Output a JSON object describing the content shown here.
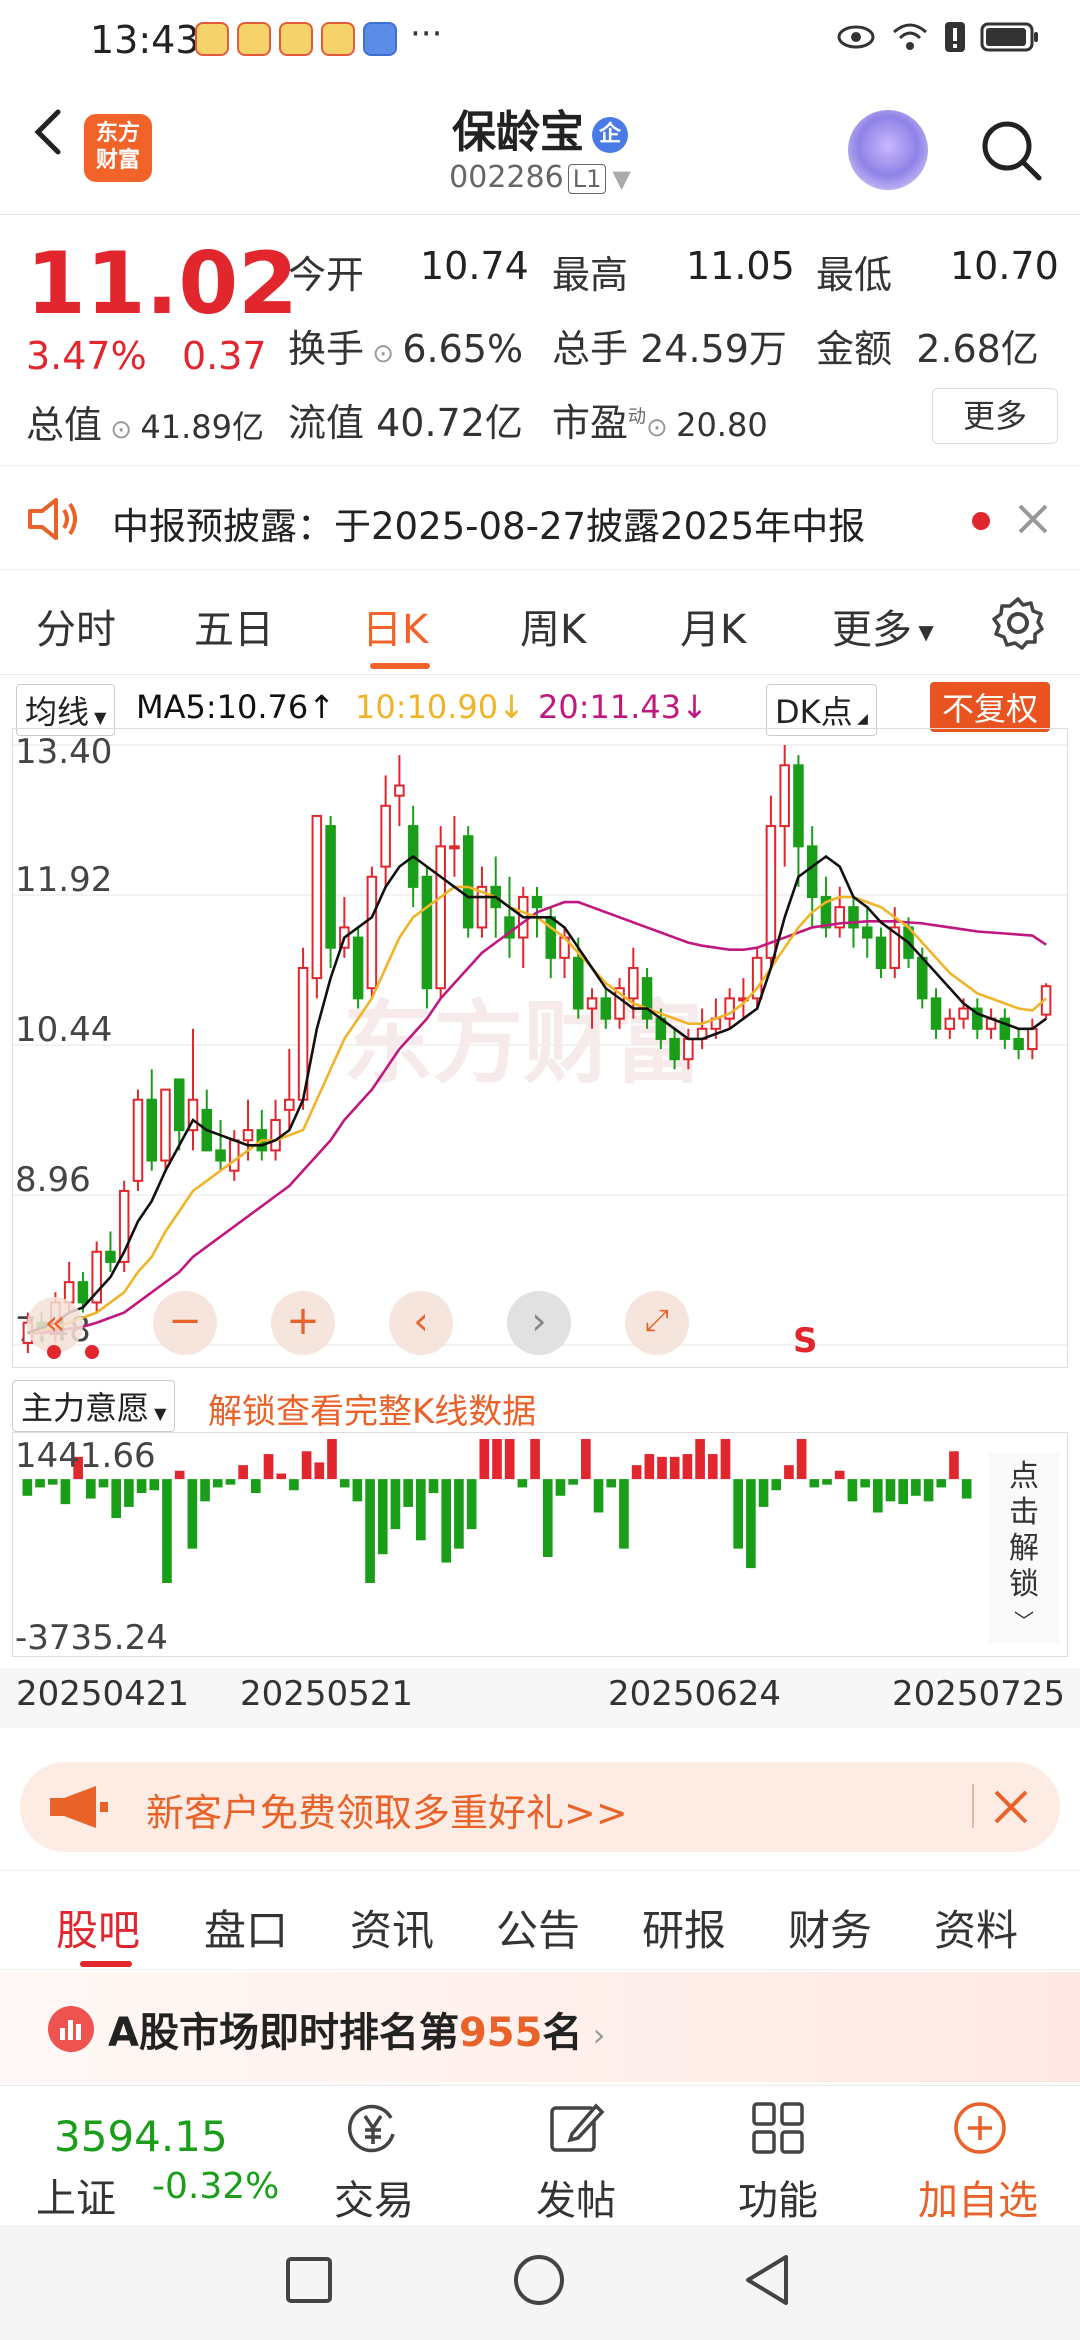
{
  "status_bar": {
    "time": "13:43",
    "dots": "···"
  },
  "header": {
    "logo_line1": "东方",
    "logo_line2": "财富",
    "stock_name": "保龄宝",
    "badge": "企",
    "stock_code": "002286",
    "level": "L1"
  },
  "quote": {
    "price": "11.02",
    "change_pct": "3.47%",
    "change_abs": "0.37",
    "open_label": "今开",
    "open": "10.74",
    "high_label": "最高",
    "high": "11.05",
    "low_label": "最低",
    "low": "10.70",
    "turnover_label": "换手",
    "turnover": "6.65%",
    "volume_label": "总手",
    "volume": "24.59万",
    "amount_label": "金额",
    "amount": "2.68亿",
    "mktcap_label": "总值",
    "mktcap": "41.89亿",
    "float_label": "流值",
    "float_cap": "40.72亿",
    "pe_label": "市盈",
    "pe_sup": "动",
    "pe": "20.80",
    "more": "更多"
  },
  "notice": {
    "text": "中报预披露：于2025-08-27披露2025年中报"
  },
  "tabs": [
    {
      "label": "分时"
    },
    {
      "label": "五日"
    },
    {
      "label": "日K"
    },
    {
      "label": "周K"
    },
    {
      "label": "月K"
    },
    {
      "label": "更多"
    }
  ],
  "chart_toolbar": {
    "ma_select": "均线",
    "ma5": "MA5:10.76↑",
    "ma10": "10:10.90↓",
    "ma20": "20:11.43↓",
    "dk": "DK点",
    "fq": "不复权"
  },
  "indicator_bar": {
    "select": "主力意愿",
    "unlock": "解锁查看完整K线数据"
  },
  "volume_side": {
    "unlock": "点击解锁"
  },
  "dates": [
    "20250421",
    "20250521",
    "20250624",
    "20250725"
  ],
  "promo": {
    "text": "新客户免费领取多重好礼>>"
  },
  "sub_tabs": [
    "股吧",
    "盘口",
    "资讯",
    "公告",
    "研报",
    "财务",
    "资料"
  ],
  "rank": {
    "prefix": "A股市场即时排名第",
    "number": "955",
    "suffix": "名"
  },
  "bottom_nav": {
    "index_value": "3594.15",
    "index_name": "上证",
    "index_change": "-0.32%",
    "trade": "交易",
    "post": "发帖",
    "func": "功能",
    "add": "加自选"
  },
  "colors": {
    "up": "#e2262e",
    "down": "#1a9e1a",
    "accent": "#f2632a",
    "ma5": "#111111",
    "ma10": "#f0b429",
    "ma20": "#c0187e"
  },
  "chart_data": {
    "type": "candlestick",
    "y_ticks": [
      "13.40",
      "11.92",
      "10.44",
      "8.96",
      "7.48"
    ],
    "ylim": [
      7.48,
      13.4
    ],
    "volume_ticks": [
      "1441.66",
      "-3735.24"
    ],
    "x_labels": [
      "20250421",
      "20250521",
      "20250624",
      "20250725"
    ],
    "legend": [
      "MA5:10.76↑",
      "10:10.90↓",
      "20:11.43↓"
    ],
    "candles": [
      [
        7.5,
        7.7,
        7.4,
        7.8
      ],
      [
        7.7,
        7.6,
        7.5,
        7.8
      ],
      [
        7.6,
        7.9,
        7.5,
        8.0
      ],
      [
        7.9,
        8.1,
        7.8,
        8.3
      ],
      [
        8.1,
        7.9,
        7.8,
        8.2
      ],
      [
        7.9,
        8.4,
        7.8,
        8.5
      ],
      [
        8.4,
        8.3,
        8.2,
        8.6
      ],
      [
        8.3,
        9.0,
        8.2,
        9.1
      ],
      [
        9.1,
        9.9,
        9.0,
        10.0
      ],
      [
        9.9,
        9.3,
        9.2,
        10.2
      ],
      [
        9.3,
        10.0,
        9.2,
        10.0
      ],
      [
        10.1,
        9.6,
        9.4,
        10.1
      ],
      [
        9.6,
        9.9,
        9.4,
        10.6
      ],
      [
        9.8,
        9.4,
        9.4,
        10.0
      ],
      [
        9.4,
        9.3,
        9.2,
        9.7
      ],
      [
        9.2,
        9.5,
        9.1,
        9.6
      ],
      [
        9.5,
        9.6,
        9.3,
        9.9
      ],
      [
        9.6,
        9.4,
        9.3,
        9.8
      ],
      [
        9.4,
        9.7,
        9.3,
        9.9
      ],
      [
        9.8,
        9.9,
        9.6,
        10.4
      ],
      [
        9.9,
        11.2,
        9.8,
        11.4
      ],
      [
        11.1,
        12.7,
        10.9,
        12.7
      ],
      [
        12.6,
        11.4,
        11.2,
        12.7
      ],
      [
        11.4,
        11.6,
        11.3,
        11.9
      ],
      [
        11.5,
        10.9,
        10.8,
        11.6
      ],
      [
        11.0,
        12.1,
        10.9,
        12.2
      ],
      [
        12.2,
        12.8,
        12.0,
        13.1
      ],
      [
        12.9,
        13.0,
        12.6,
        13.3
      ],
      [
        12.6,
        12.0,
        11.8,
        12.8
      ],
      [
        12.1,
        11.0,
        10.8,
        12.2
      ],
      [
        11.0,
        12.4,
        10.9,
        12.6
      ],
      [
        12.4,
        12.4,
        12.1,
        12.7
      ],
      [
        12.5,
        11.6,
        11.5,
        12.6
      ],
      [
        11.6,
        12.0,
        11.5,
        12.2
      ],
      [
        12.0,
        11.8,
        11.5,
        12.3
      ],
      [
        11.7,
        11.5,
        11.3,
        12.1
      ],
      [
        11.5,
        11.9,
        11.2,
        12.0
      ],
      [
        11.9,
        11.8,
        11.5,
        12.0
      ],
      [
        11.7,
        11.3,
        11.1,
        11.8
      ],
      [
        11.3,
        11.5,
        11.1,
        11.6
      ],
      [
        11.3,
        10.8,
        10.7,
        11.5
      ],
      [
        10.8,
        10.9,
        10.6,
        11.0
      ],
      [
        10.9,
        10.7,
        10.6,
        11.0
      ],
      [
        10.7,
        11.0,
        10.6,
        11.1
      ],
      [
        10.9,
        11.2,
        10.7,
        11.4
      ],
      [
        11.1,
        10.7,
        10.6,
        11.2
      ],
      [
        10.7,
        10.5,
        10.4,
        10.8
      ],
      [
        10.5,
        10.3,
        10.2,
        10.6
      ],
      [
        10.3,
        10.5,
        10.2,
        10.6
      ],
      [
        10.5,
        10.6,
        10.4,
        10.8
      ],
      [
        10.6,
        10.7,
        10.5,
        10.9
      ],
      [
        10.7,
        10.9,
        10.6,
        11.0
      ],
      [
        10.9,
        10.9,
        10.7,
        11.1
      ],
      [
        10.9,
        11.3,
        10.8,
        11.4
      ],
      [
        11.3,
        12.6,
        11.2,
        12.9
      ],
      [
        12.6,
        13.2,
        12.2,
        13.4
      ],
      [
        13.2,
        12.4,
        12.0,
        13.3
      ],
      [
        12.4,
        11.9,
        11.6,
        12.6
      ],
      [
        11.9,
        11.6,
        11.5,
        12.1
      ],
      [
        11.6,
        11.8,
        11.5,
        12.0
      ],
      [
        11.8,
        11.6,
        11.4,
        11.9
      ],
      [
        11.6,
        11.5,
        11.3,
        11.8
      ],
      [
        11.5,
        11.2,
        11.1,
        11.6
      ],
      [
        11.2,
        11.6,
        11.1,
        11.8
      ],
      [
        11.6,
        11.3,
        11.2,
        11.7
      ],
      [
        11.3,
        10.9,
        10.8,
        11.4
      ],
      [
        10.9,
        10.6,
        10.5,
        11.0
      ],
      [
        10.6,
        10.7,
        10.5,
        10.8
      ],
      [
        10.7,
        10.8,
        10.6,
        10.9
      ],
      [
        10.8,
        10.6,
        10.5,
        10.9
      ],
      [
        10.6,
        10.7,
        10.5,
        10.8
      ],
      [
        10.7,
        10.5,
        10.4,
        10.8
      ],
      [
        10.5,
        10.4,
        10.3,
        10.6
      ],
      [
        10.4,
        10.6,
        10.3,
        10.7
      ],
      [
        10.74,
        11.02,
        10.7,
        11.05
      ]
    ],
    "ma5": [
      7.6,
      7.65,
      7.7,
      7.8,
      7.85,
      8.0,
      8.15,
      8.4,
      8.7,
      8.9,
      9.2,
      9.45,
      9.7,
      9.6,
      9.55,
      9.5,
      9.45,
      9.45,
      9.5,
      9.6,
      9.9,
      10.6,
      11.1,
      11.5,
      11.6,
      11.7,
      12.0,
      12.2,
      12.3,
      12.2,
      12.1,
      12.0,
      11.9,
      11.9,
      11.9,
      11.8,
      11.7,
      11.7,
      11.7,
      11.6,
      11.4,
      11.2,
      11.0,
      10.9,
      10.8,
      10.8,
      10.7,
      10.6,
      10.5,
      10.5,
      10.55,
      10.6,
      10.7,
      10.8,
      11.2,
      11.7,
      12.1,
      12.2,
      12.3,
      12.2,
      11.9,
      11.8,
      11.65,
      11.55,
      11.45,
      11.3,
      11.15,
      11.0,
      10.85,
      10.75,
      10.7,
      10.65,
      10.6,
      10.6,
      10.7
    ],
    "ma10": [
      7.6,
      7.62,
      7.65,
      7.7,
      7.75,
      7.8,
      7.9,
      8.0,
      8.2,
      8.35,
      8.6,
      8.8,
      9.0,
      9.1,
      9.2,
      9.3,
      9.4,
      9.5,
      9.5,
      9.55,
      9.6,
      9.9,
      10.2,
      10.5,
      10.7,
      10.9,
      11.2,
      11.5,
      11.7,
      11.8,
      11.9,
      12.0,
      12.0,
      11.95,
      11.9,
      11.8,
      11.75,
      11.7,
      11.6,
      11.5,
      11.35,
      11.2,
      11.05,
      10.95,
      10.85,
      10.8,
      10.75,
      10.7,
      10.65,
      10.65,
      10.7,
      10.75,
      10.85,
      11.0,
      11.2,
      11.4,
      11.6,
      11.75,
      11.85,
      11.9,
      11.9,
      11.85,
      11.8,
      11.7,
      11.6,
      11.45,
      11.3,
      11.15,
      11.05,
      10.95,
      10.9,
      10.85,
      10.8,
      10.78,
      10.9
    ],
    "ma20": [
      7.6,
      7.6,
      7.62,
      7.64,
      7.66,
      7.7,
      7.75,
      7.8,
      7.9,
      8.0,
      8.1,
      8.2,
      8.35,
      8.45,
      8.55,
      8.65,
      8.75,
      8.85,
      8.95,
      9.05,
      9.2,
      9.35,
      9.5,
      9.7,
      9.85,
      10.0,
      10.2,
      10.4,
      10.55,
      10.7,
      10.9,
      11.05,
      11.2,
      11.35,
      11.45,
      11.55,
      11.65,
      11.75,
      11.8,
      11.85,
      11.85,
      11.8,
      11.75,
      11.7,
      11.65,
      11.6,
      11.55,
      11.5,
      11.45,
      11.42,
      11.4,
      11.38,
      11.38,
      11.4,
      11.45,
      11.5,
      11.55,
      11.6,
      11.62,
      11.64,
      11.65,
      11.66,
      11.66,
      11.66,
      11.65,
      11.64,
      11.62,
      11.6,
      11.58,
      11.56,
      11.55,
      11.54,
      11.53,
      11.52,
      11.43
    ],
    "volume": [
      -600,
      -300,
      -200,
      -900,
      800,
      -700,
      -300,
      -1400,
      -1000,
      -500,
      -400,
      -3735,
      300,
      -2500,
      -800,
      -300,
      -200,
      500,
      -500,
      900,
      200,
      -400,
      1000,
      600,
      1441,
      -300,
      -800,
      -3735,
      -2700,
      -1800,
      -1000,
      -2200,
      -500,
      -3000,
      -2500,
      -1800,
      1441,
      1441,
      1441,
      -300,
      1441,
      -2800,
      -600,
      -200,
      1441,
      -1200,
      -300,
      -2500,
      500,
      900,
      800,
      800,
      900,
      1441,
      900,
      1441,
      -2500,
      -3200,
      -1000,
      -400,
      500,
      1441,
      -300,
      -200,
      300,
      -800,
      -300,
      -1200,
      -800,
      -900,
      -600,
      -800,
      -300,
      1000,
      -700
    ]
  }
}
